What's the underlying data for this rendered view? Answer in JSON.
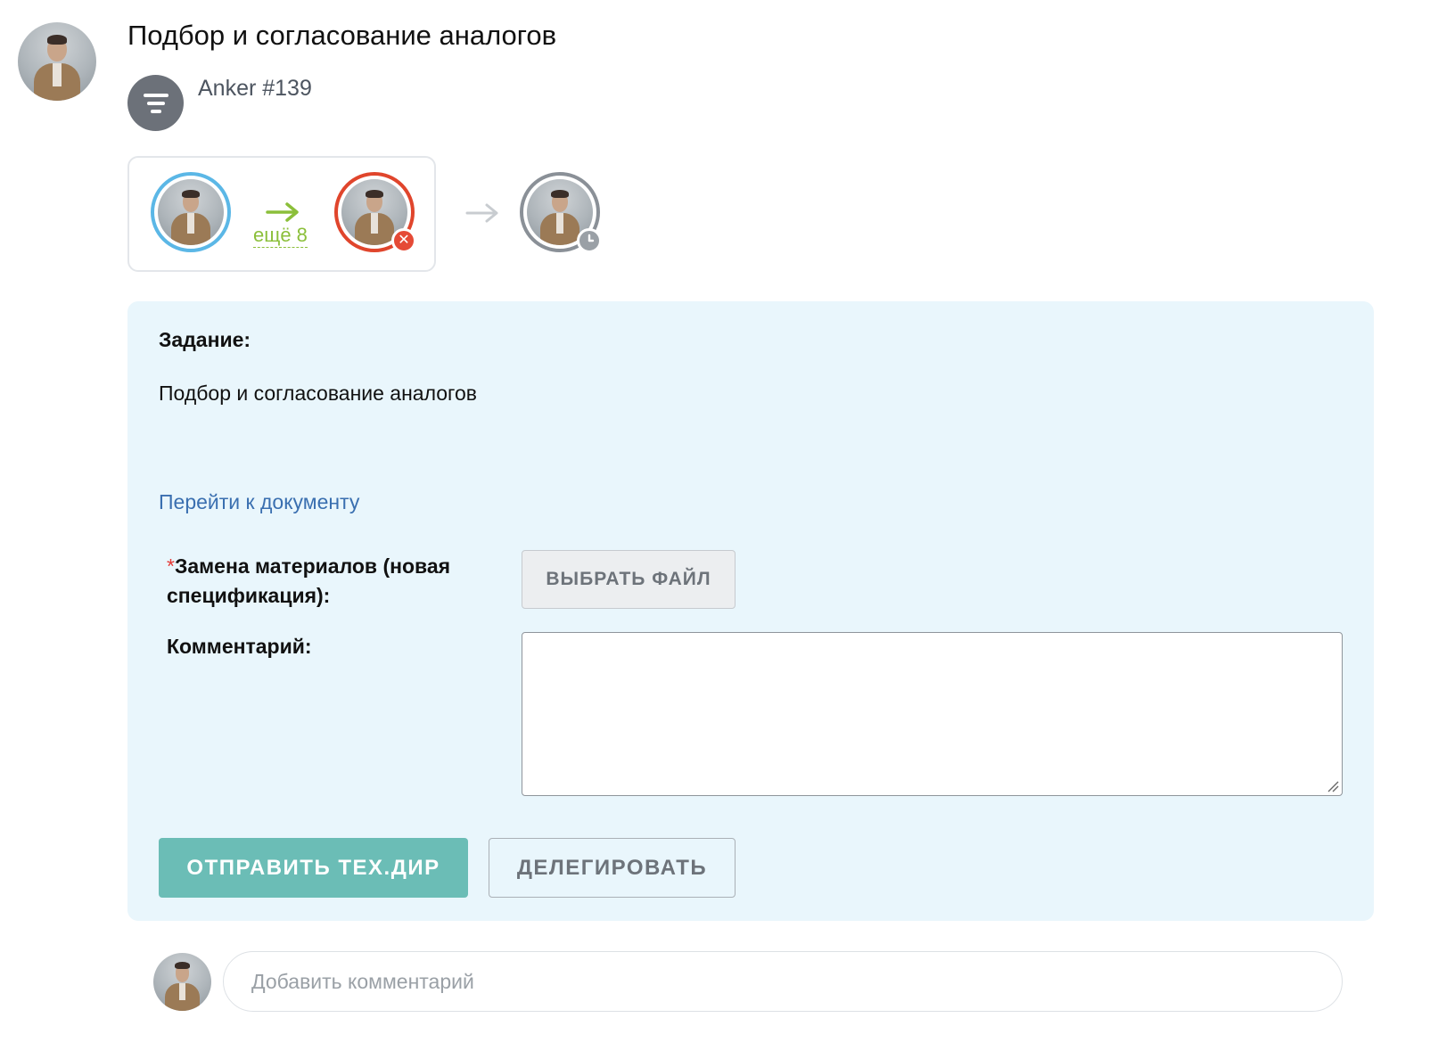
{
  "header": {
    "title": "Подбор и согласование аналогов",
    "document_ref": "Anker #139",
    "task_type_icon": "filter-funnel-icon"
  },
  "route": {
    "more_label": "ещё 8",
    "first_step_color": "#5bb7e6",
    "current_step_color": "#e0452c",
    "current_step_status_icon": "cancel-icon",
    "next_step_color": "#8a9097",
    "next_step_status_icon": "clock-icon",
    "arrow_active_color": "#8bbf3a",
    "arrow_inactive_color": "#c8ccd0"
  },
  "task": {
    "heading": "Задание:",
    "text": "Подбор и согласование аналогов",
    "document_link": "Перейти к документу",
    "file_field": {
      "required_mark": "*",
      "label": "Замена материалов (новая спецификация):",
      "button_label": "ВЫБРАТЬ ФАЙЛ"
    },
    "comment_field": {
      "label": "Комментарий:",
      "value": ""
    },
    "actions": {
      "send_label": "ОТПРАВИТЬ ТЕХ.ДИР",
      "delegate_label": "ДЕЛЕГИРОВАТЬ"
    },
    "panel_color": "#e9f6fc",
    "primary_color": "#6bbdb6"
  },
  "comments": {
    "placeholder": "Добавить комментарий"
  }
}
